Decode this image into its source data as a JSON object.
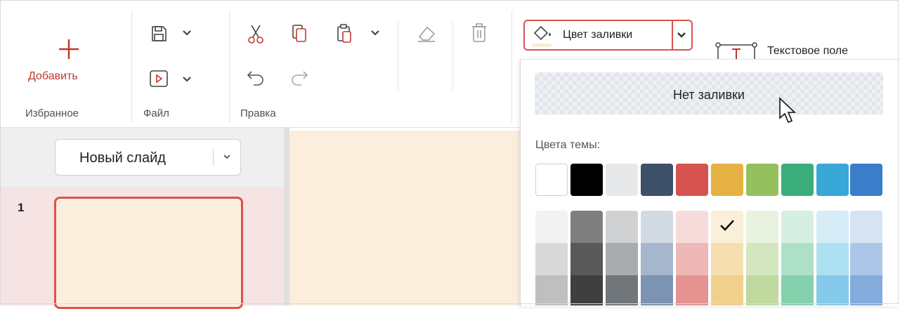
{
  "toolbar": {
    "favorites": {
      "add_label": "Добавить",
      "group_label": "Избранное"
    },
    "file": {
      "group_label": "Файл"
    },
    "edit": {
      "group_label": "Правка"
    },
    "fill_color": {
      "label": "Цвет заливки"
    },
    "next_group_partial": "Текстовое поле"
  },
  "icons": [
    "plus-icon",
    "save-icon",
    "play-icon",
    "cut-icon",
    "copy-icon",
    "paste-icon",
    "undo-icon",
    "redo-icon",
    "eraser-icon",
    "delete-icon",
    "paint-bucket-icon",
    "chevron-down-icon",
    "text-box-icon",
    "cursor-icon",
    "checkmark-icon"
  ],
  "slides_panel": {
    "new_slide_label": "Новый слайд",
    "slides": [
      {
        "number": "1"
      }
    ]
  },
  "fill_dropdown": {
    "no_fill_label": "Нет заливки",
    "theme_colors_label": "Цвета темы:",
    "theme_colors": [
      "#ffffff",
      "#000000",
      "#e7e8ea",
      "#3e5069",
      "#d6544f",
      "#e6b143",
      "#94c15e",
      "#3aad7a",
      "#38a7d8",
      "#3a7dc9"
    ],
    "shades": [
      [
        "#f2f2f2",
        "#d9d9d9",
        "#bfbfbf"
      ],
      [
        "#7f7f7f",
        "#595959",
        "#3f3f3f"
      ],
      [
        "#d0d1d3",
        "#a9acae",
        "#71767a"
      ],
      [
        "#d1d9e3",
        "#a6b6cc",
        "#7d93b2"
      ],
      [
        "#f5dcdb",
        "#edb8b6",
        "#e49391"
      ],
      [
        "#faefd8",
        "#f5dfb1",
        "#f0d08a"
      ],
      [
        "#e9f2de",
        "#d4e6bf",
        "#bfd99e"
      ],
      [
        "#d6efe3",
        "#aee0c8",
        "#85d0ad"
      ],
      [
        "#d6ecf7",
        "#ade0f1",
        "#85c9eb"
      ],
      [
        "#d6e3f3",
        "#adc6e8",
        "#85aadc"
      ]
    ],
    "selected": "shade-6-1"
  },
  "colors": {
    "accent": "#d9534f",
    "canvas": "#fbeedd",
    "panel": "#efefef",
    "slide_list": "#f6e3e3"
  }
}
